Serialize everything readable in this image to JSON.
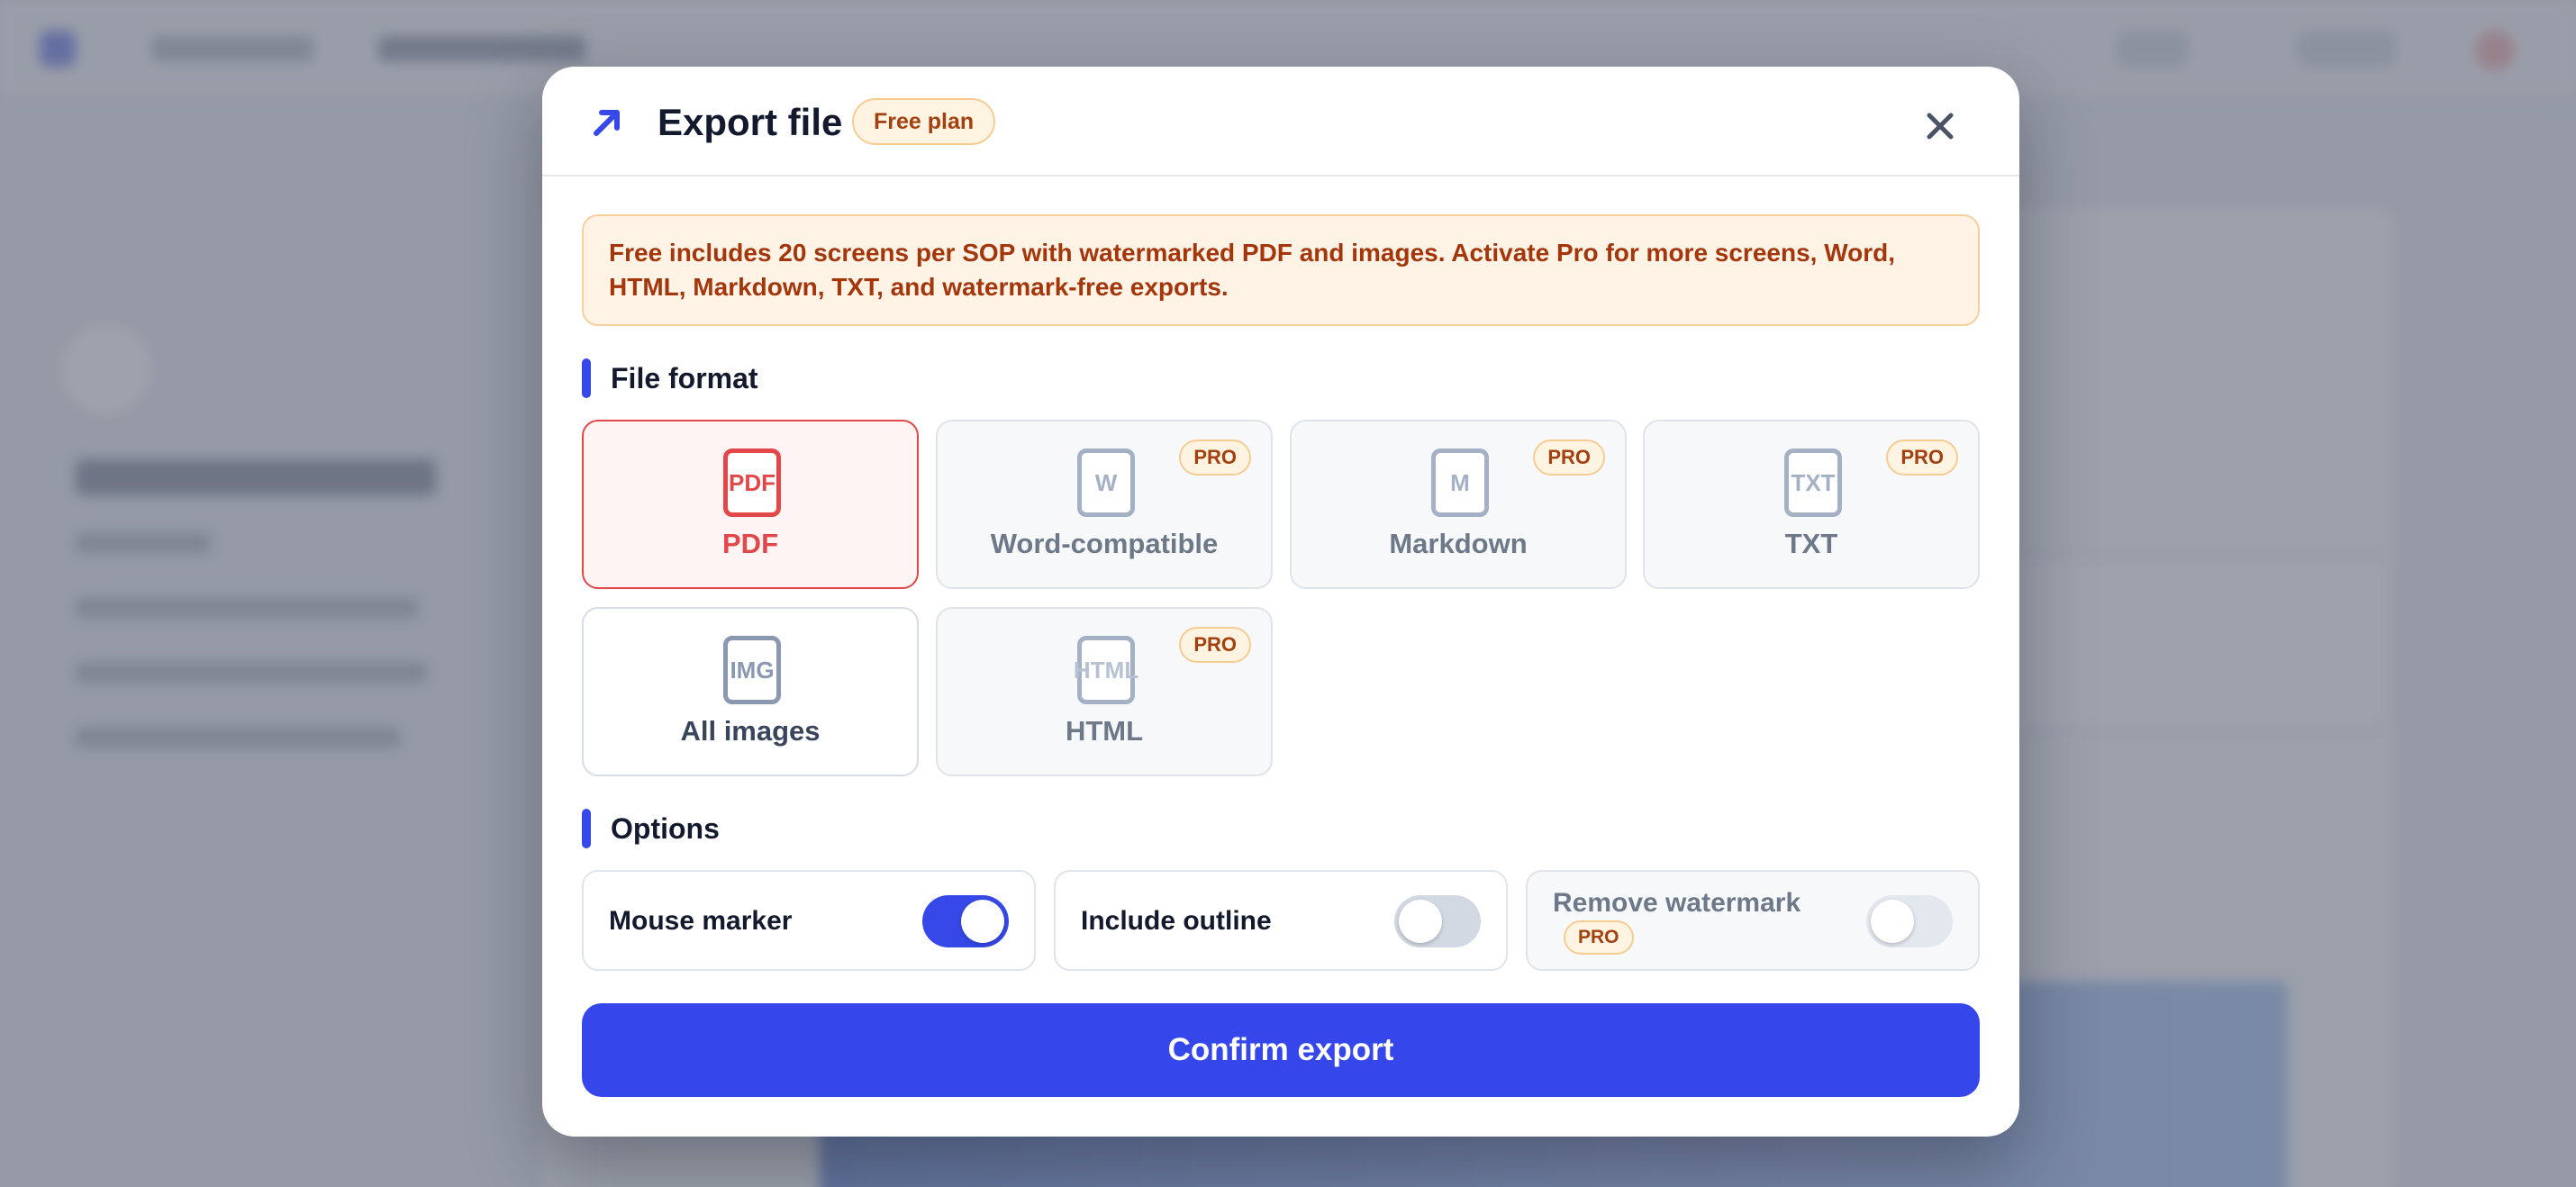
{
  "modal": {
    "title": "Export file",
    "plan_badge": "Free plan",
    "notice": "Free includes 20 screens per SOP with watermarked PDF and images. Activate Pro for more screens, Word, HTML, Markdown, TXT, and watermark-free exports.",
    "icons": {
      "header": "arrow-up-right-icon",
      "close": "close-icon"
    }
  },
  "file_format": {
    "title": "File format",
    "options": [
      {
        "label": "PDF",
        "icon_text": "PDF",
        "selected": true,
        "pro": false
      },
      {
        "label": "Word-compatible",
        "icon_text": "W",
        "selected": false,
        "pro": true,
        "pro_label": "PRO"
      },
      {
        "label": "Markdown",
        "icon_text": "M",
        "selected": false,
        "pro": true,
        "pro_label": "PRO"
      },
      {
        "label": "TXT",
        "icon_text": "TXT",
        "selected": false,
        "pro": true,
        "pro_label": "PRO"
      },
      {
        "label": "All images",
        "icon_text": "IMG",
        "selected": false,
        "pro": false
      },
      {
        "label": "HTML",
        "icon_text": "HTML",
        "selected": false,
        "pro": true,
        "pro_label": "PRO"
      }
    ]
  },
  "options": {
    "title": "Options",
    "items": [
      {
        "label": "Mouse marker",
        "enabled": true
      },
      {
        "label": "Include outline",
        "enabled": false
      },
      {
        "label": "Remove watermark",
        "enabled": false,
        "pro_label": "PRO"
      }
    ]
  },
  "confirm_label": "Confirm export",
  "colors": {
    "accent": "#3547ea",
    "selected": "#e2474a",
    "pro_badge_text": "#a3400f",
    "notice_background": "#fff3e6"
  }
}
